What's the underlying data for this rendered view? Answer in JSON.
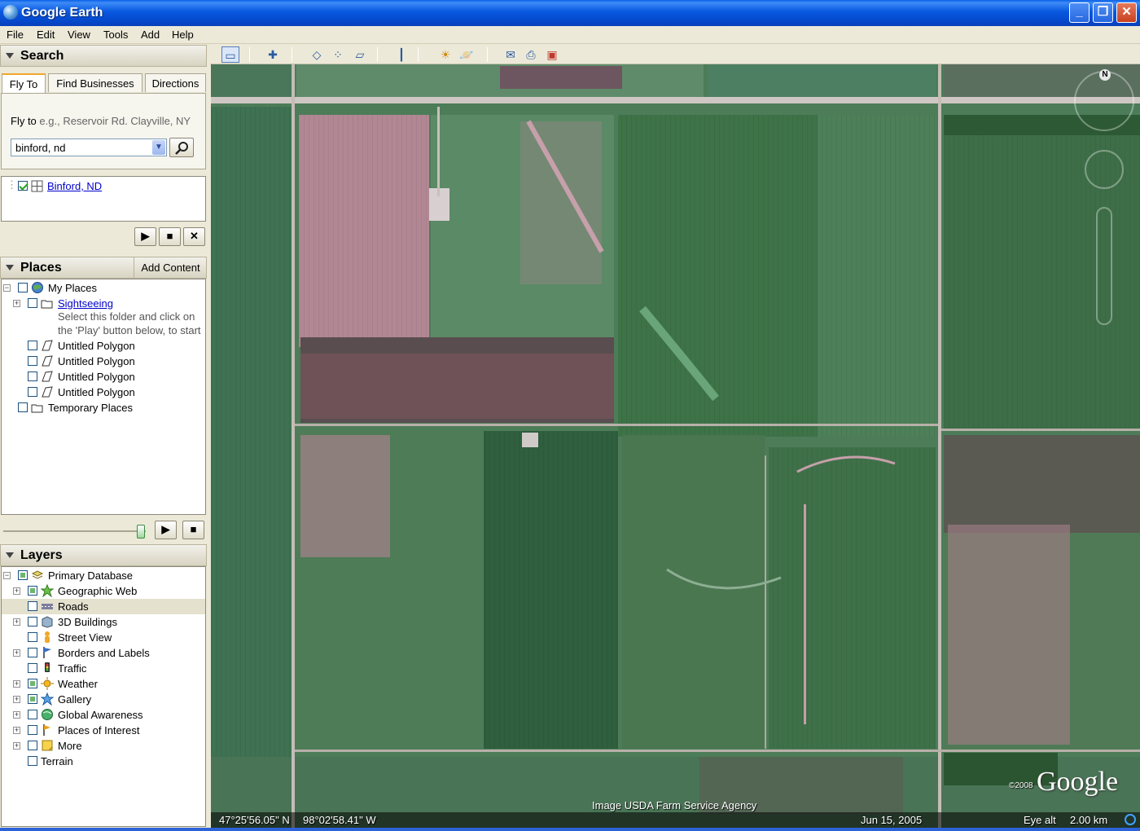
{
  "window": {
    "title": "Google Earth"
  },
  "menu": [
    "File",
    "Edit",
    "View",
    "Tools",
    "Add",
    "Help"
  ],
  "search": {
    "header": "Search",
    "tabs": [
      "Fly To",
      "Find Businesses",
      "Directions"
    ],
    "active_tab": "Fly To",
    "fly_to_label": "Fly to",
    "fly_to_hint": "e.g., Reservoir Rd. Clayville, NY",
    "query_value": "binford, nd",
    "result": "Binford, ND"
  },
  "places": {
    "header": "Places",
    "add_content_label": "Add Content",
    "items": [
      {
        "label": "My Places"
      },
      {
        "label": "Sightseeing"
      },
      {
        "label": "Untitled Polygon"
      },
      {
        "label": "Untitled Polygon"
      },
      {
        "label": "Untitled Polygon"
      },
      {
        "label": "Untitled Polygon"
      },
      {
        "label": "Temporary Places"
      }
    ],
    "sightseeing_hint_1": "Select this folder and click on",
    "sightseeing_hint_2": "the 'Play' button below, to start"
  },
  "layers": {
    "header": "Layers",
    "items": [
      {
        "label": "Primary Database"
      },
      {
        "label": "Geographic Web"
      },
      {
        "label": "Roads"
      },
      {
        "label": "3D Buildings"
      },
      {
        "label": "Street View"
      },
      {
        "label": "Borders and Labels"
      },
      {
        "label": "Traffic"
      },
      {
        "label": "Weather"
      },
      {
        "label": "Gallery"
      },
      {
        "label": "Global Awareness"
      },
      {
        "label": "Places of Interest"
      },
      {
        "label": "More"
      },
      {
        "label": "Terrain"
      }
    ]
  },
  "map": {
    "latitude": "47°25'56.05\" N",
    "longitude": "98°02'58.41\" W",
    "imagery_credit": "Image USDA Farm Service Agency",
    "imagery_date": "Jun 15, 2005",
    "eye_alt_label": "Eye alt",
    "eye_alt_value": "2.00 km",
    "copyright_year": "©2008",
    "logo": "Google",
    "compass_north": "N"
  },
  "colors": {
    "titlebar": "#0858e0",
    "panel_bg": "#ece9d8",
    "link": "#0000cc",
    "field_green": "#3f7a4c",
    "field_pink": "#b88a99"
  }
}
